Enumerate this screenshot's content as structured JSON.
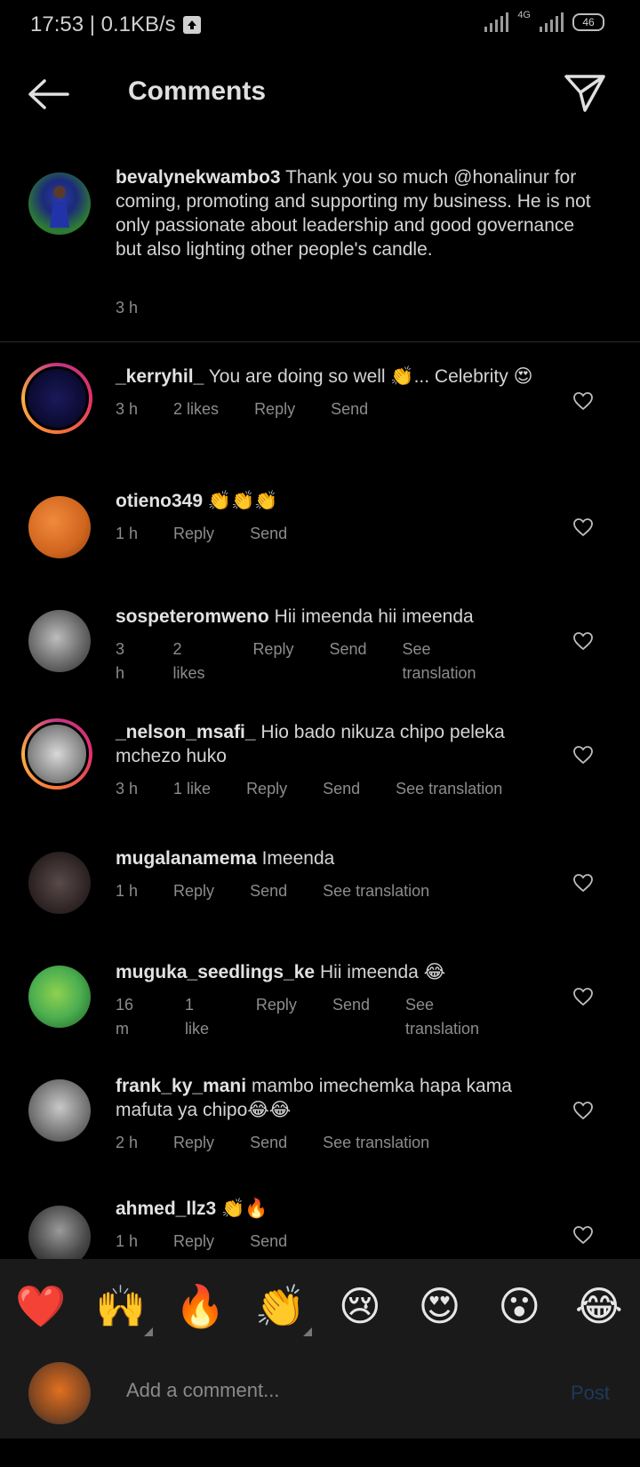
{
  "status_bar": {
    "time_speed": "17:53 | 0.1KB/s",
    "network": "4G",
    "battery": "46"
  },
  "header": {
    "title": "Comments",
    "back_icon": "back-arrow-icon",
    "send_icon": "paper-plane-icon"
  },
  "caption": {
    "username": "bevalynekwambo3",
    "text": "Thank you so much @honalinur for coming, promoting and supporting my business. He is not only passionate about leadership and good governance but also lighting other people's candle.",
    "time": "3 h"
  },
  "comments": [
    {
      "username": "_kerryhil_",
      "text": "You are doing so well 👏... Celebrity 😍",
      "time": "3 h",
      "likes": "2 likes",
      "reply": "Reply",
      "send": "Send",
      "translation": ""
    },
    {
      "username": "otieno349",
      "text": "👏👏👏",
      "time": "1 h",
      "likes": "",
      "reply": "Reply",
      "send": "Send",
      "translation": ""
    },
    {
      "username": "sospeteromweno",
      "text": "Hii imeenda hii imeenda",
      "time": "3 h",
      "likes": "2 likes",
      "reply": "Reply",
      "send": "Send",
      "translation": "See translation"
    },
    {
      "username": "_nelson_msafi_",
      "text": "Hio bado nikuza chipo peleka mchezo huko",
      "time": "3 h",
      "likes": "1 like",
      "reply": "Reply",
      "send": "Send",
      "translation": "See translation"
    },
    {
      "username": "mugalanamema",
      "text": "Imeenda",
      "time": "1 h",
      "likes": "",
      "reply": "Reply",
      "send": "Send",
      "translation": "See translation"
    },
    {
      "username": "muguka_seedlings_ke",
      "text": "Hii imeenda 😂",
      "time": "16 m",
      "likes": "1 like",
      "reply": "Reply",
      "send": "Send",
      "translation": "See translation"
    },
    {
      "username": "frank_ky_mani",
      "text": "mambo imechemka hapa kama mafuta ya chipo😂😂",
      "time": "2 h",
      "likes": "",
      "reply": "Reply",
      "send": "Send",
      "translation": "See translation"
    },
    {
      "username": "ahmed_llz3",
      "text": "👏🔥",
      "time": "1 h",
      "likes": "",
      "reply": "Reply",
      "send": "Send",
      "translation": ""
    }
  ],
  "emoji_bar": [
    "❤️",
    "🙌",
    "🔥",
    "👏",
    "😢",
    "😍",
    "😮",
    "😂"
  ],
  "input": {
    "placeholder": "Add a comment...",
    "post_label": "Post"
  },
  "colors": {
    "background": "#000000",
    "panel": "#1a1a1a",
    "muted_text": "#8c8c8c",
    "post_disabled": "#1e3a5c"
  }
}
